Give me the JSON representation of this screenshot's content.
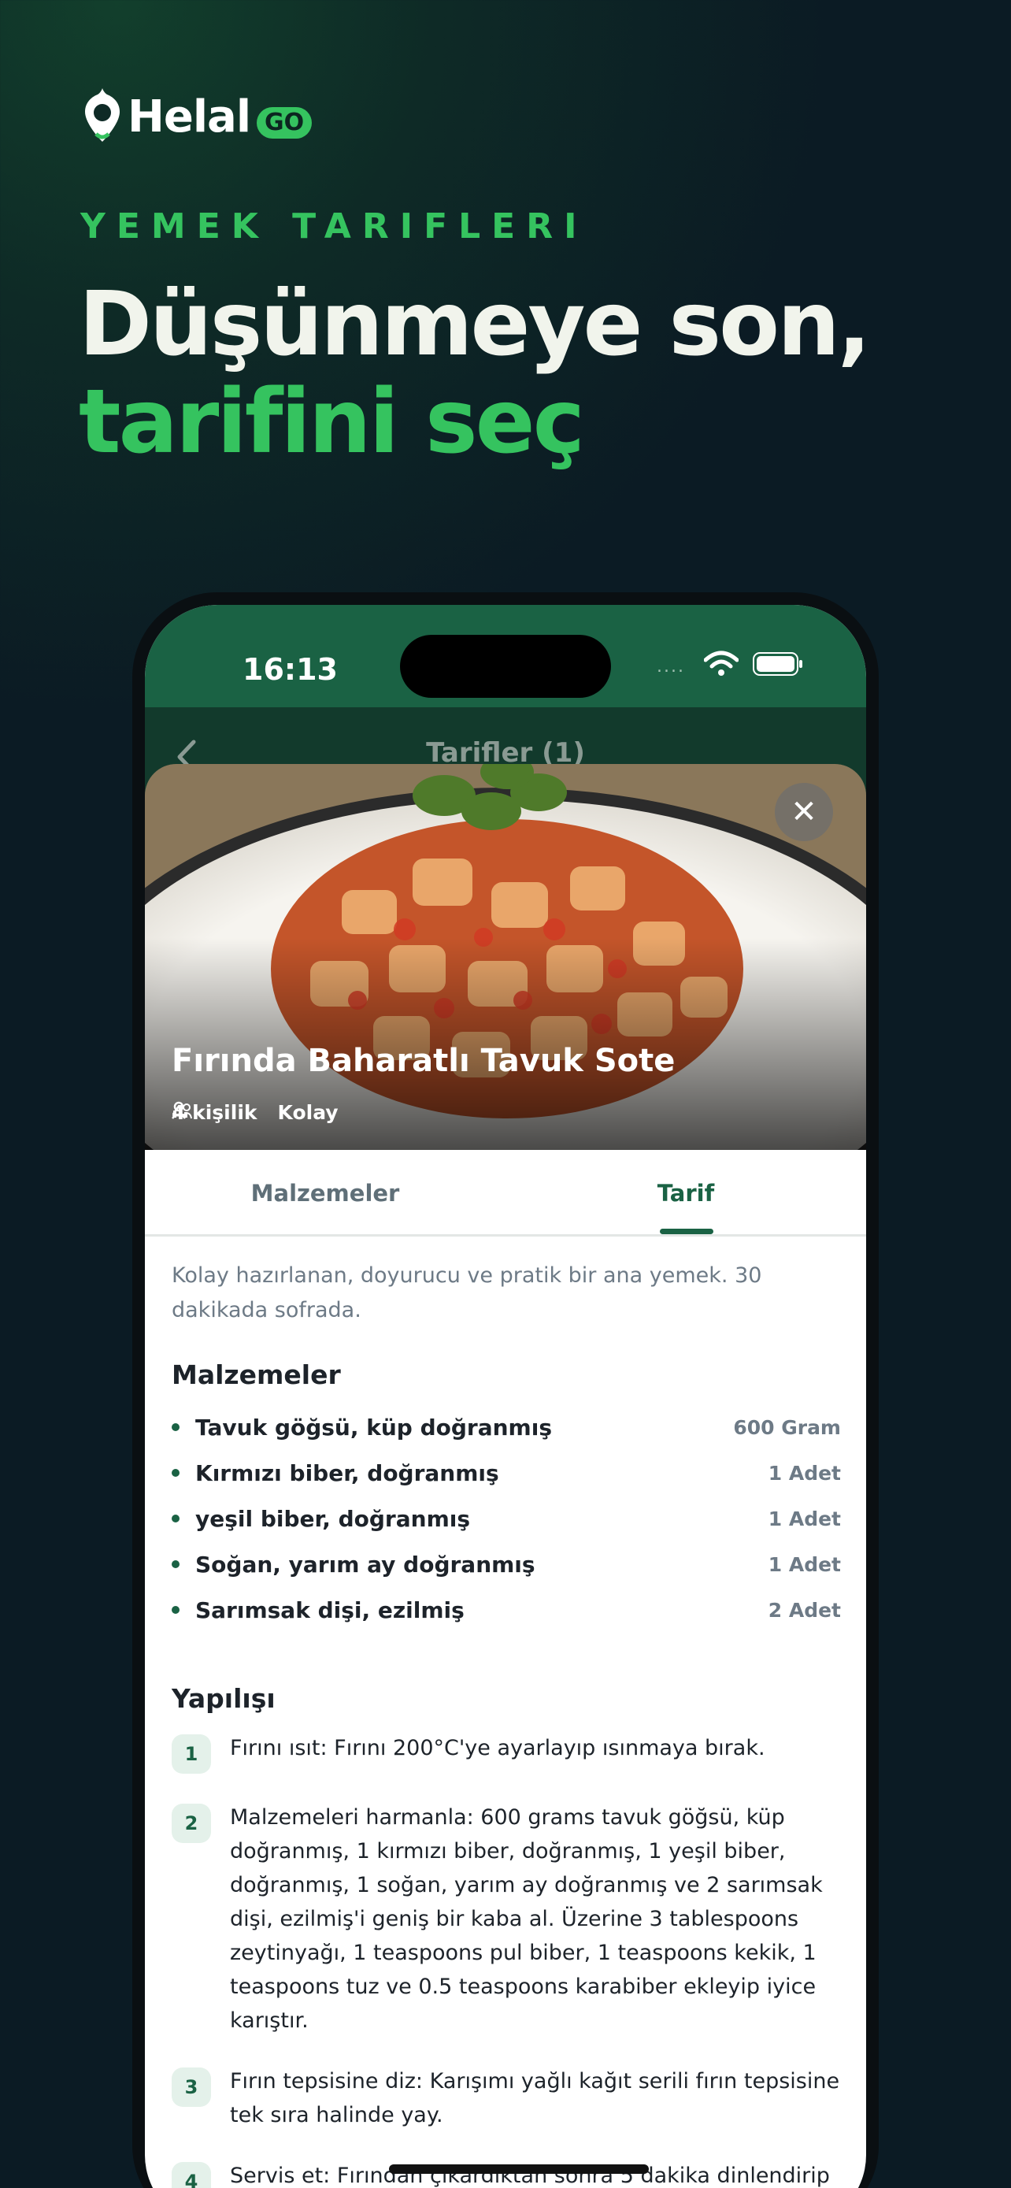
{
  "brand": {
    "name": "Helal",
    "badge": "GO",
    "accent": "#35c35f"
  },
  "marketing": {
    "eyebrow": "YEMEK TARIFLERI",
    "headline_line1": "Düşünmeye son,",
    "headline_line2": "tarifini seç"
  },
  "status_bar": {
    "time": "16:13",
    "signal": "....",
    "icons": [
      "wifi-icon",
      "battery-icon"
    ]
  },
  "nav": {
    "title": "Tarifler (1)",
    "back_icon": "chevron-left-icon"
  },
  "recipe": {
    "title": "Fırında Baharatlı Tavuk Sote",
    "servings": "4 kişilik",
    "difficulty": "Kolay",
    "close_icon": "close-icon",
    "description": "Kolay hazırlanan, doyurucu ve pratik bir ana yemek. 30 dakikada sofrada."
  },
  "tabs": [
    {
      "label": "Malzemeler",
      "active": false
    },
    {
      "label": "Tarif",
      "active": true
    }
  ],
  "ingredients": {
    "heading": "Malzemeler",
    "items": [
      {
        "name": "Tavuk göğsü, küp doğranmış",
        "qty": "600 Gram"
      },
      {
        "name": "Kırmızı biber, doğranmış",
        "qty": "1 Adet"
      },
      {
        "name": "yeşil biber, doğranmış",
        "qty": "1 Adet"
      },
      {
        "name": "Soğan, yarım ay doğranmış",
        "qty": "1 Adet"
      },
      {
        "name": "Sarımsak dişi, ezilmiş",
        "qty": "2 Adet"
      }
    ]
  },
  "steps": {
    "heading": "Yapılışı",
    "items": [
      {
        "num": "1",
        "text": "Fırını ısıt: Fırını 200°C'ye ayarlayıp ısınmaya bırak."
      },
      {
        "num": "2",
        "text": "Malzemeleri harmanla: 600 grams tavuk göğsü, küp doğranmış, 1 kırmızı biber, doğranmış, 1 yeşil biber, doğranmış, 1 soğan, yarım ay doğranmış ve 2 sarımsak dişi, ezilmiş'i geniş bir kaba al. Üzerine 3 tablespoons zeytinyağı, 1 teaspoons pul biber, 1 teaspoons kekik, 1 teaspoons tuz ve 0.5 teaspoons karabiber ekleyip iyice karıştır."
      },
      {
        "num": "3",
        "text": "Fırın tepsisine diz: Karışımı yağlı kağıt serili fırın tepsisine tek sıra halinde yay."
      },
      {
        "num": "4",
        "text": "Servis et: Fırından çıkardıktan sonra 5 dakika dinlendirip"
      }
    ]
  }
}
